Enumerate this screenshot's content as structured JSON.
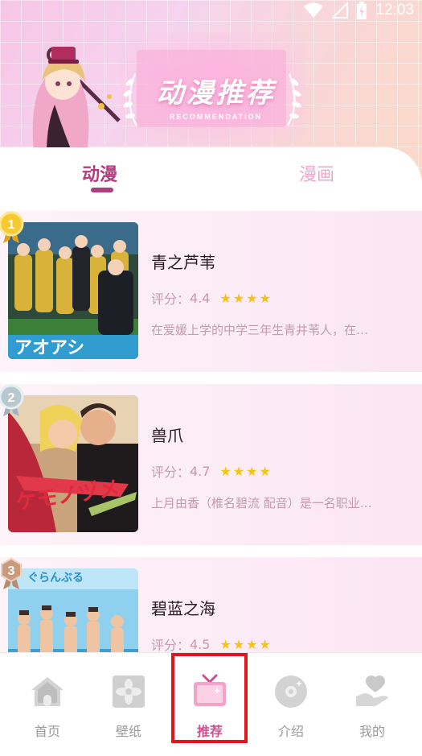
{
  "status_bar": {
    "time": "12:03",
    "icons": [
      "wifi-icon",
      "signal-icon",
      "battery-icon"
    ]
  },
  "banner": {
    "title": "动漫推荐",
    "subtitle": "RECOMMENDATION"
  },
  "tabs": [
    {
      "label": "动漫",
      "active": true
    },
    {
      "label": "漫画",
      "active": false
    }
  ],
  "items": [
    {
      "rank": "1",
      "title": "青之芦苇",
      "rating_label": "评分：",
      "rating": "4.4",
      "stars": "★★★★",
      "desc": "在爱媛上学的中学三年生青井苇人，在…"
    },
    {
      "rank": "2",
      "title": "兽爪",
      "rating_label": "评分：",
      "rating": "4.7",
      "stars": "★★★★",
      "desc": "上月由香（椎名碧流 配音）是一名职业…"
    },
    {
      "rank": "3",
      "title": "碧蓝之海",
      "rating_label": "评分：",
      "rating": "4.5",
      "stars": "★★★★",
      "desc": ""
    }
  ],
  "nav": [
    {
      "label": "首页",
      "icon": "home-icon"
    },
    {
      "label": "壁纸",
      "icon": "wallpaper-icon"
    },
    {
      "label": "推荐",
      "icon": "tv-icon",
      "active": true
    },
    {
      "label": "介绍",
      "icon": "disc-icon"
    },
    {
      "label": "我的",
      "icon": "heart-hand-icon"
    }
  ],
  "colors": {
    "accent": "#b03d7e",
    "active_nav": "#d0508f",
    "star": "#f2c416",
    "muted": "#c79aae",
    "highlight": "#e4141b"
  }
}
